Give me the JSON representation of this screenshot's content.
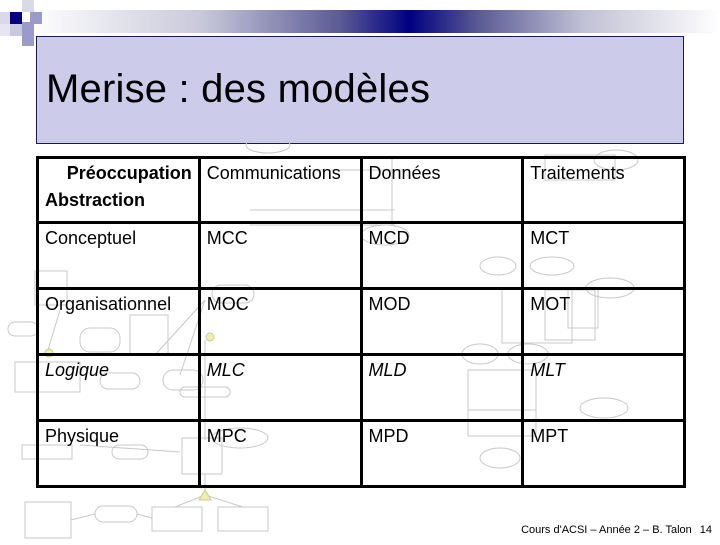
{
  "slide": {
    "title": "Merise : des modèles",
    "accent_color": "#000080",
    "title_bg_color": "#ccccea"
  },
  "table": {
    "corner": {
      "top_label": "Préoccupation",
      "bottom_label": "Abstraction"
    },
    "columns": [
      "Communications",
      "Données",
      "Traitements"
    ],
    "rows": [
      {
        "level": "Conceptuel",
        "italic": false,
        "cells": [
          "MCC",
          "MCD",
          "MCT"
        ]
      },
      {
        "level": "Organisationnel",
        "italic": false,
        "cells": [
          "MOC",
          "MOD",
          "MOT"
        ]
      },
      {
        "level": "Logique",
        "italic": true,
        "cells": [
          "MLC",
          "MLD",
          "MLT"
        ]
      },
      {
        "level": "Physique",
        "italic": false,
        "cells": [
          "MPC",
          "MPD",
          "MPT"
        ]
      }
    ]
  },
  "footer": {
    "text": "Cours d'ACSI – Année 2 – B. Talon",
    "page_number": "14"
  }
}
